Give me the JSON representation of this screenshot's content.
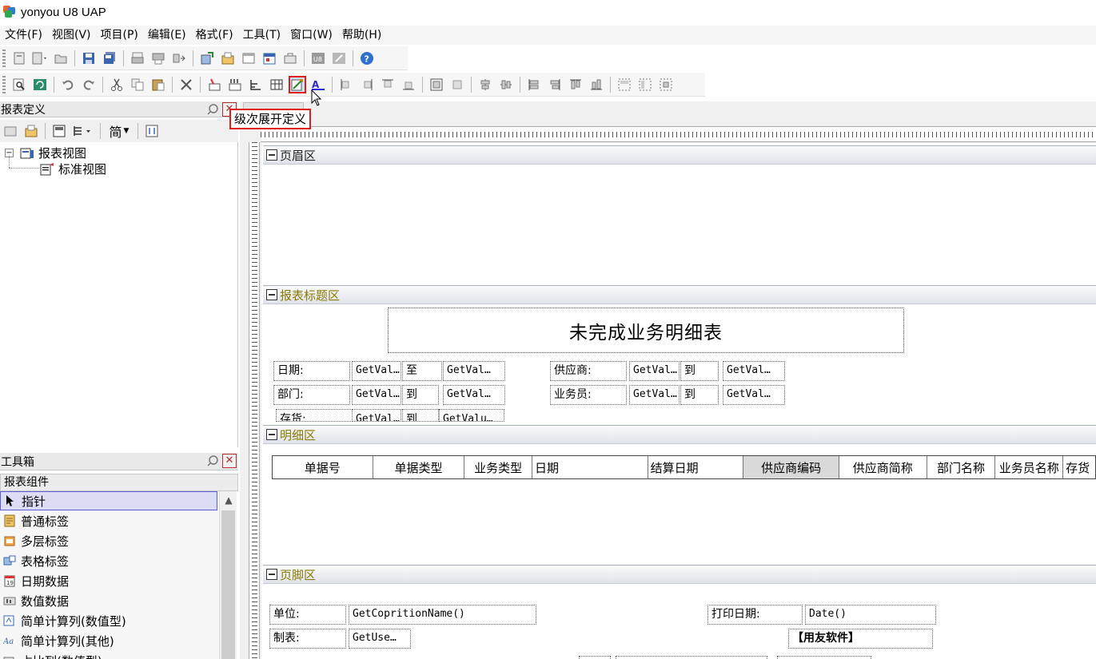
{
  "window": {
    "title": "yonyou U8 UAP"
  },
  "menu": [
    "文件(F)",
    "视图(V)",
    "项目(P)",
    "编辑(E)",
    "格式(F)",
    "工具(T)",
    "窗口(W)",
    "帮助(H)"
  ],
  "tooltip": "级次展开定义",
  "report_definition_panel": {
    "title": "报表定义",
    "toolbar_dropdown_label": "简",
    "tree": {
      "root": "报表视图",
      "child": "标准视图"
    }
  },
  "toolbox": {
    "title": "工具箱",
    "group": "报表组件",
    "items": [
      "指针",
      "普通标签",
      "多层标签",
      "表格标签",
      "日期数据",
      "数值数据",
      "简单计算列(数值型)",
      "简单计算列(其他)",
      "占比列(数值型)"
    ]
  },
  "sections": {
    "page_header": "页眉区",
    "report_title_area": "报表标题区",
    "detail": "明细区",
    "page_footer": "页脚区"
  },
  "report": {
    "title": "未完成业务明细表",
    "conditions": {
      "date_label": "日期:",
      "date_from": "GetVal…",
      "to1": "至",
      "date_to": "GetVal…",
      "dept_label": "部门:",
      "dept_from": "GetVal…",
      "to2": "到",
      "dept_to": "GetVal…",
      "inv_label": "存货:",
      "inv_from": "GetVal…",
      "to3": "到",
      "inv_to": "GetValu…",
      "supplier_label": "供应商:",
      "supplier_from": "GetVal…",
      "to4": "到",
      "supplier_to": "GetVal…",
      "clerk_label": "业务员:",
      "clerk_from": "GetVal…",
      "to5": "到",
      "clerk_to": "GetVal…"
    },
    "columns": [
      "单据号",
      "单据类型",
      "业务类型",
      "日期",
      "结算日期",
      "供应商编码",
      "供应商简称",
      "部门名称",
      "业务员名称",
      "存货"
    ],
    "footer": {
      "unit_label": "单位:",
      "unit_value": "GetCopritionName()",
      "maker_label": "制表:",
      "maker_value": "GetUse…",
      "print_date_label": "打印日期:",
      "print_date_value": "Date()",
      "brand": "【用友软件】"
    }
  },
  "colors": {
    "accent_red": "#e21b1b",
    "section_title": "#8a7a00",
    "selection": "#5c5cd6"
  }
}
